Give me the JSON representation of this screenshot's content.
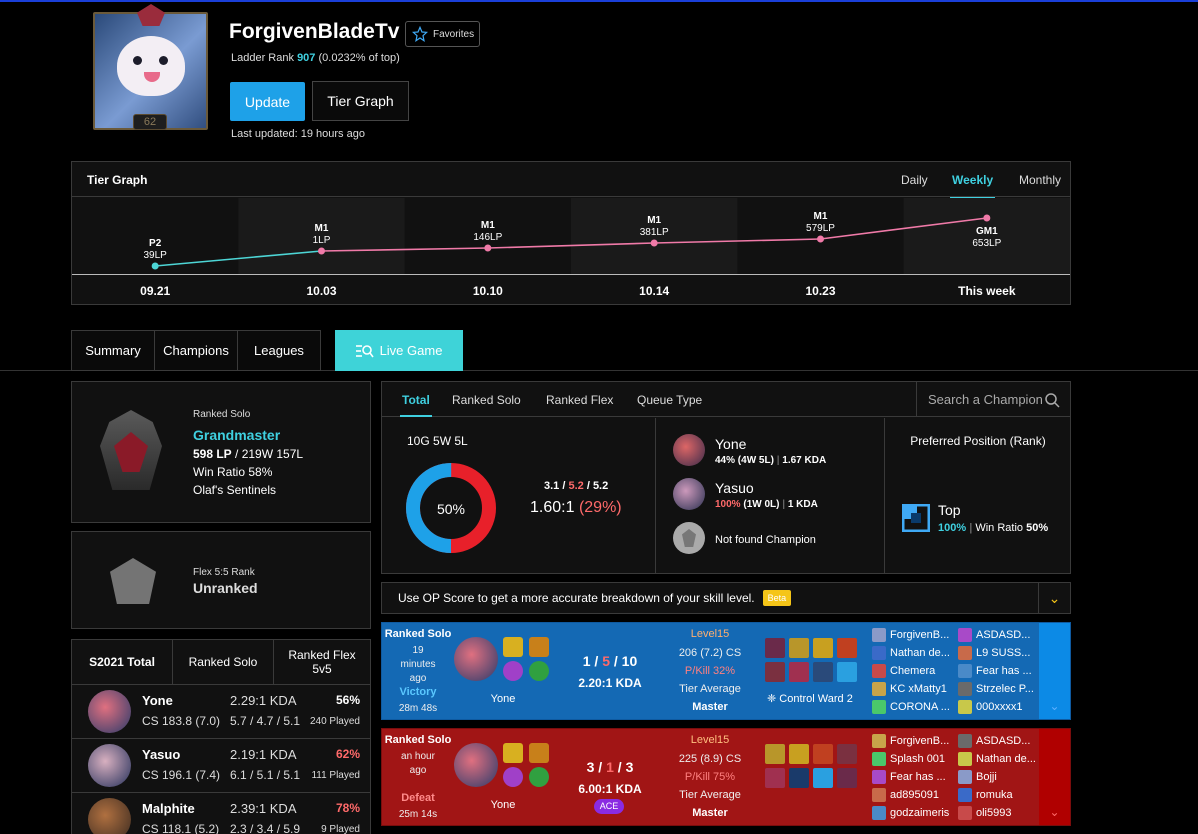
{
  "header": {
    "summoner_name": "ForgivenBladeTv",
    "level": "62",
    "favorites_label": "Favorites",
    "ladder_label": "Ladder Rank",
    "ladder_rank": "907",
    "ladder_pct": "(0.0232% of top)",
    "update_label": "Update",
    "tier_graph_label": "Tier Graph",
    "last_updated": "Last updated: 19 hours ago"
  },
  "tier_graph": {
    "title": "Tier Graph",
    "tabs": [
      "Daily",
      "Weekly",
      "Monthly"
    ],
    "active_tab": "Weekly",
    "colors": {
      "plat": "#4dd6d6",
      "master": "#f07aa8"
    },
    "chart_data": {
      "type": "line",
      "x": [
        "09.21",
        "10.03",
        "10.10",
        "10.14",
        "10.23",
        "This week"
      ],
      "tiers": [
        "P2",
        "M1",
        "M1",
        "M1",
        "M1",
        "GM1"
      ],
      "lp_labels": [
        "39LP",
        "1LP",
        "146LP",
        "381LP",
        "579LP",
        "653LP"
      ]
    }
  },
  "nav": {
    "tabs": [
      "Summary",
      "Champions",
      "Leagues"
    ],
    "live_game": "Live Game"
  },
  "ranked_solo": {
    "label": "Ranked Solo",
    "tier": "Grandmaster",
    "lp": "598 LP",
    "record": " / 219W 157L",
    "win_ratio": "Win Ratio 58%",
    "league": "Olaf's Sentinels"
  },
  "flex": {
    "label": "Flex 5:5 Rank",
    "tier": "Unranked"
  },
  "season": {
    "tabs": [
      "S2021 Total",
      "Ranked Solo",
      "Ranked Flex 5v5"
    ],
    "champions": [
      {
        "name": "Yone",
        "kda": "2.29:1 KDA",
        "cs": "CS 183.8 (7.0)",
        "kda_detail": "5.7 / 4.7 / 5.1",
        "winrate": "56%",
        "played": "240 Played",
        "wr_color": "#ffffff"
      },
      {
        "name": "Yasuo",
        "kda": "2.19:1 KDA",
        "cs": "CS 196.1 (7.4)",
        "kda_detail": "6.1 / 5.1 / 5.1",
        "winrate": "62%",
        "played": "111 Played",
        "wr_color": "#ff6a6a"
      },
      {
        "name": "Malphite",
        "kda": "2.39:1 KDA",
        "cs": "CS 118.1 (5.2)",
        "kda_detail": "2.3 / 3.4 / 5.9",
        "winrate": "78%",
        "played": "9 Played",
        "wr_color": "#ff6a6a"
      }
    ]
  },
  "stats": {
    "tabs": [
      "Total",
      "Ranked Solo",
      "Ranked Flex",
      "Queue Type"
    ],
    "search_placeholder": "Search a Champion",
    "record": "10G 5W 5L",
    "win_pct": "50%",
    "win_fraction": 0.5,
    "kda_k": "3.1",
    "kda_d": "5.2",
    "kda_a": "5.2",
    "kda_ratio": "1.60:1",
    "kp": "(29%)",
    "recent_champs": [
      {
        "name": "Yone",
        "wr": "44%",
        "rec": "(4W 5L)",
        "kda": "1.67 KDA"
      },
      {
        "name": "Yasuo",
        "wr": "100%",
        "rec": "(1W 0L)",
        "kda": "1 KDA"
      }
    ],
    "not_found": "Not found Champion",
    "preferred_title": "Preferred Position (Rank)",
    "position": "Top",
    "position_pct": "100%",
    "position_wr_label": "Win Ratio",
    "position_wr": "50%"
  },
  "op_score": {
    "text": "Use OP Score to get a more accurate breakdown of your skill level.",
    "beta": "Beta"
  },
  "matches": [
    {
      "queue": "Ranked Solo",
      "ago": "19 minutes ago",
      "result": "Victory",
      "duration": "28m 48s",
      "champion": "Yone",
      "k": "1",
      "d": "5",
      "a": "10",
      "kda": "2.20:1 KDA",
      "level": "Level15",
      "cs": "206 (7.2) CS",
      "pkill": "P/Kill 32%",
      "tier_avg": "Tier Average",
      "tier": "Master",
      "ward": "Control Ward 2",
      "team1": [
        "ForgivenB...",
        "Nathan de...",
        "Chemera",
        "KC xMatty1",
        "CORONA ..."
      ],
      "team2": [
        "ASDASD...",
        "L9 SUSS...",
        "Fear has ...",
        "Strzelec P...",
        "000xxxx1"
      ]
    },
    {
      "queue": "Ranked Solo",
      "ago": "an hour ago",
      "result": "Defeat",
      "duration": "25m 14s",
      "champion": "Yone",
      "k": "3",
      "d": "1",
      "a": "3",
      "kda": "6.00:1 KDA",
      "badge": "ACE",
      "level": "Level15",
      "cs": "225 (8.9) CS",
      "pkill": "P/Kill 75%",
      "tier_avg": "Tier Average",
      "tier": "Master",
      "team1": [
        "ForgivenB...",
        "Splash 001",
        "Fear has ...",
        "ad895091",
        "godzaimeris"
      ],
      "team2": [
        "ASDASD...",
        "Nathan de...",
        "Bojji",
        "romuka",
        "oli5993"
      ]
    }
  ]
}
